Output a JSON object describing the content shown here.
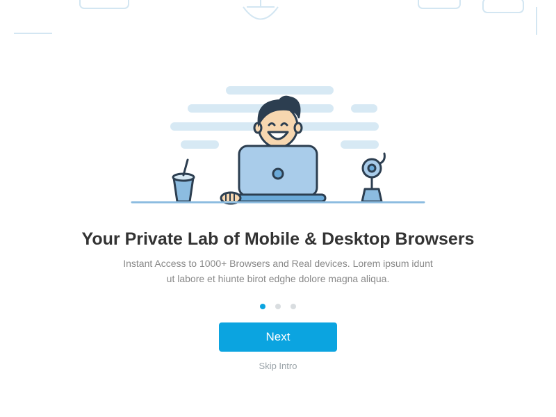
{
  "headline": "Your Private Lab of Mobile & Desktop Browsers",
  "subhead": "Instant Access to 1000+ Browsers and Real devices. Lorem ipsum idunt ut labore et  hiunte birot edghe dolore magna aliqua.",
  "cta_label": "Next",
  "skip_label": "Skip Intro",
  "pager": {
    "count": 3,
    "active_index": 0
  },
  "colors": {
    "accent": "#0ba4e0",
    "stroke": "#2c3e50",
    "cloud": "#d7e9f4",
    "skin": "#f7d7b0",
    "hair": "#2c3e50",
    "laptop_body": "#a9ccea",
    "laptop_base": "#6aa9d8",
    "cup": "#8cbce0",
    "plant_pot": "#8cbce0",
    "plant_leaf": "#a9ccea",
    "desk": "#8cbce0"
  }
}
